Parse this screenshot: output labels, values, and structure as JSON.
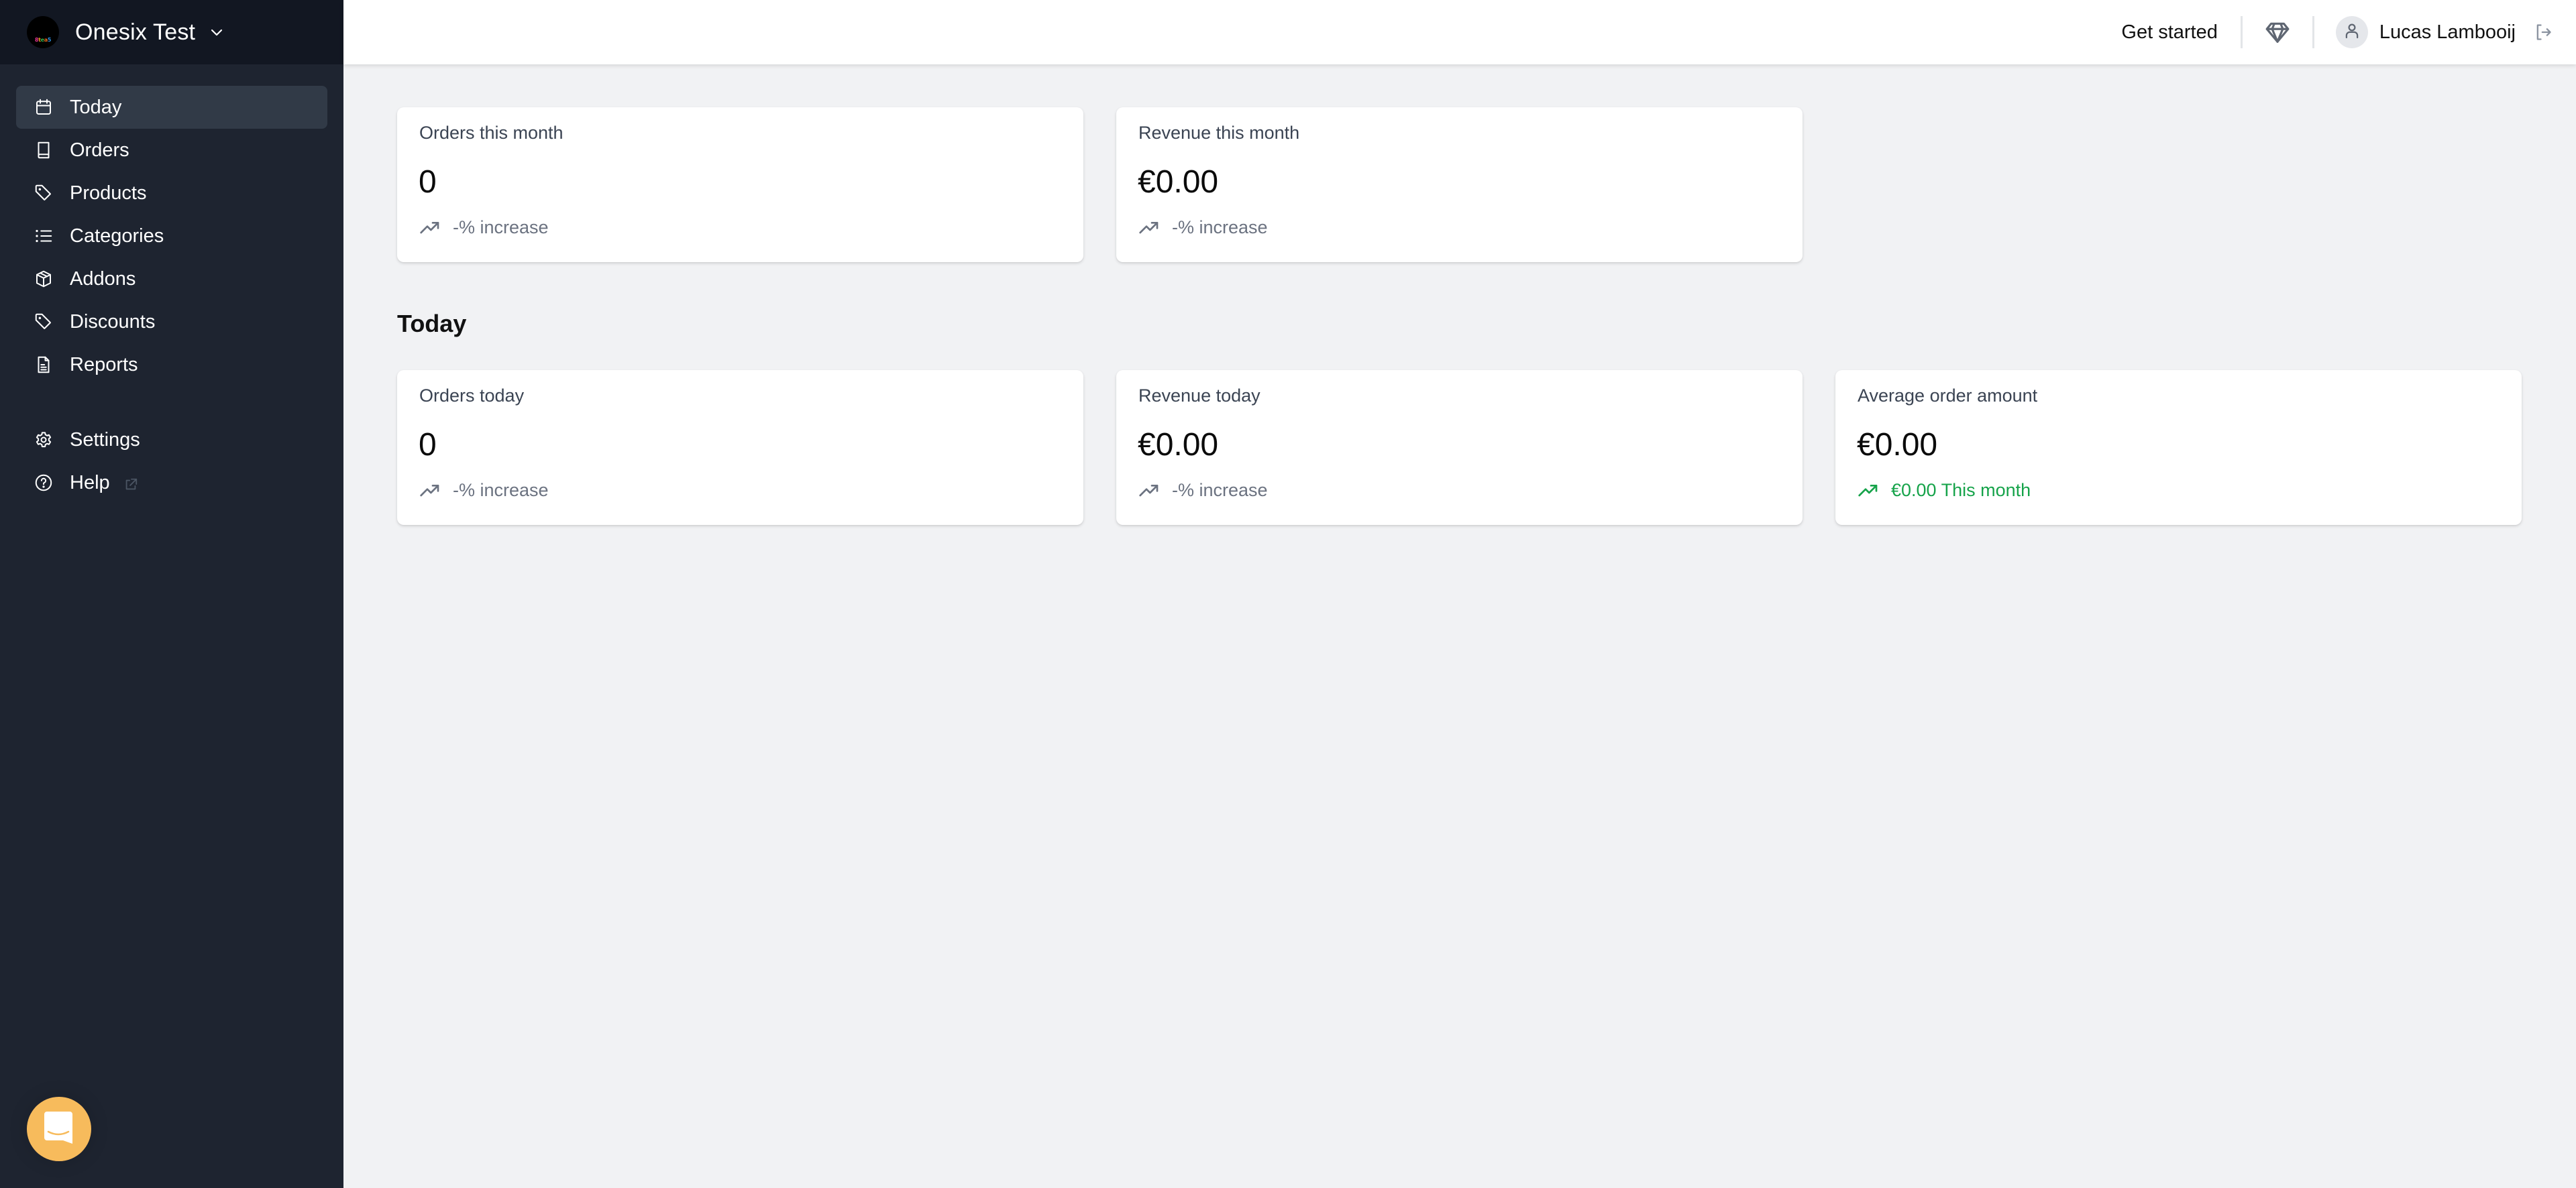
{
  "org": {
    "name": "Onesix Test",
    "logo_text": [
      "8",
      "t",
      "e",
      "a",
      "5"
    ],
    "switcher_icon": "chevron-down-icon"
  },
  "sidebar": {
    "items": [
      {
        "label": "Today",
        "icon": "calendar-icon",
        "active": true
      },
      {
        "label": "Orders",
        "icon": "book-icon",
        "active": false
      },
      {
        "label": "Products",
        "icon": "tag-icon",
        "active": false
      },
      {
        "label": "Categories",
        "icon": "list-icon",
        "active": false
      },
      {
        "label": "Addons",
        "icon": "cube-icon",
        "active": false
      },
      {
        "label": "Discounts",
        "icon": "tag-icon",
        "active": false
      },
      {
        "label": "Reports",
        "icon": "document-icon",
        "active": false
      }
    ],
    "bottom_items": [
      {
        "label": "Settings",
        "icon": "gear-icon"
      },
      {
        "label": "Help",
        "icon": "question-circle-icon",
        "external": true
      }
    ],
    "chat_icon": "chat-bubble-icon"
  },
  "topbar": {
    "get_started_label": "Get started",
    "upgrade_icon": "diamond-icon",
    "user_name": "Lucas Lambooij",
    "avatar_icon": "user-icon",
    "logout_icon": "logout-icon"
  },
  "colors": {
    "accent_positive": "#16a34a",
    "chat_button": "#f7bb5c",
    "sidebar_bg": "#1e2430"
  },
  "month_cards": [
    {
      "title": "Orders this month",
      "value": "0",
      "trend": "-% increase"
    },
    {
      "title": "Revenue this month",
      "value": "€0.00",
      "trend": "-% increase"
    }
  ],
  "today_section": {
    "title": "Today",
    "cards": [
      {
        "title": "Orders today",
        "value": "0",
        "trend": "-% increase"
      },
      {
        "title": "Revenue today",
        "value": "€0.00",
        "trend": "-% increase"
      },
      {
        "title": "Average order amount",
        "value": "€0.00",
        "trend": "€0.00 This month",
        "positive": true
      }
    ]
  }
}
